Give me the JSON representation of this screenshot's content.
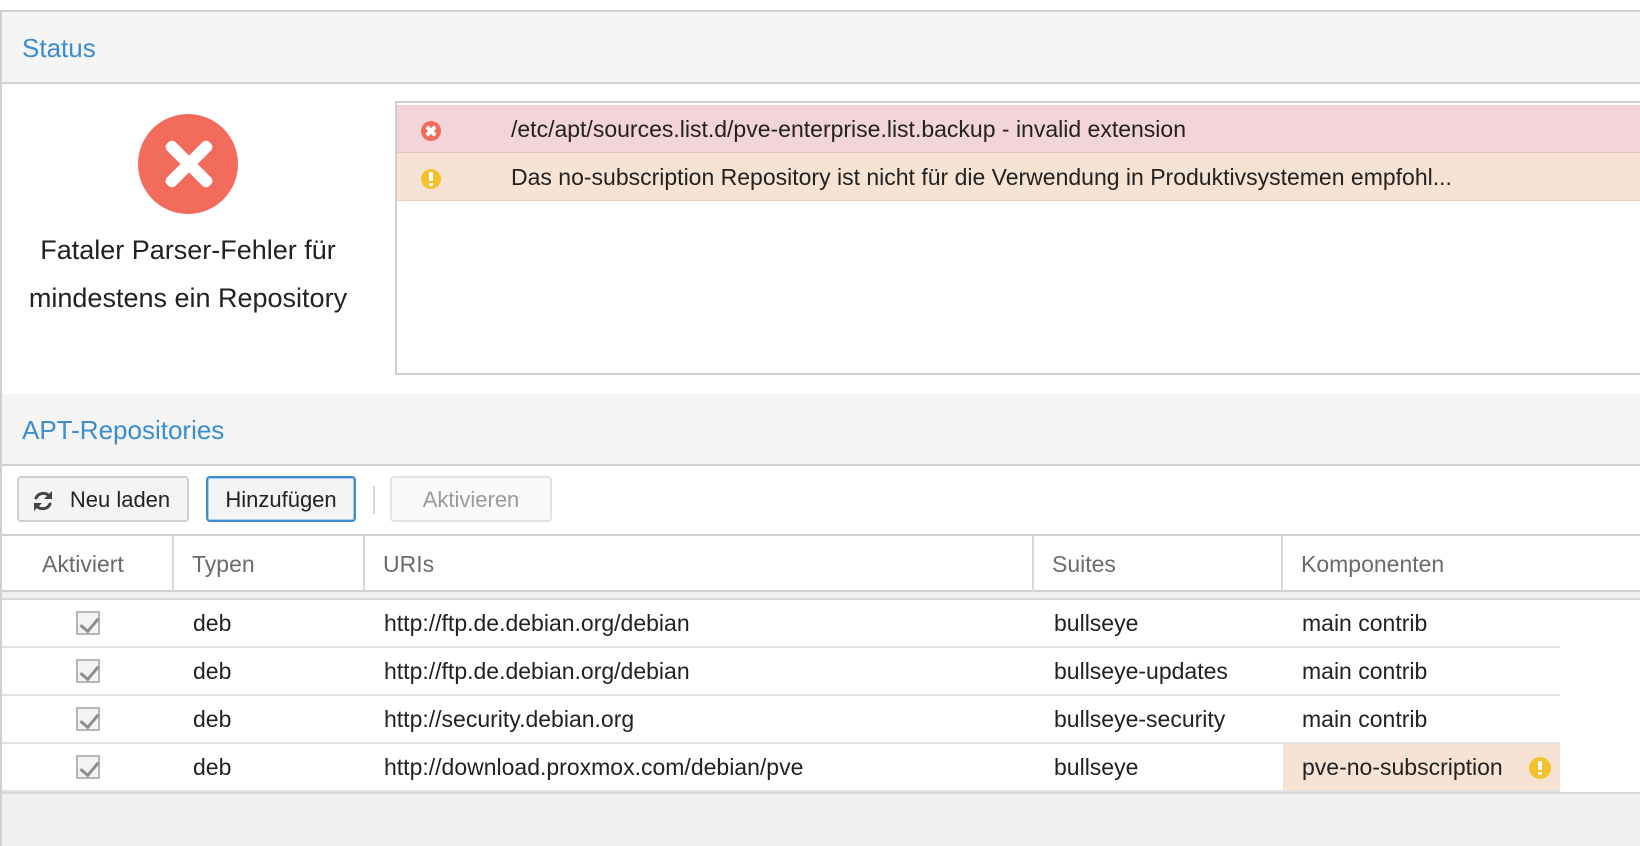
{
  "status_panel": {
    "title": "Status",
    "summary_icon": "error-circle-icon",
    "summary_text": "Fataler Parser-Fehler für mindestens ein Repository",
    "issues": [
      {
        "level": "error",
        "icon": "error-icon",
        "message": "/etc/apt/sources.list.d/pve-enterprise.list.backup - invalid extension"
      },
      {
        "level": "warning",
        "icon": "warning-icon",
        "message": "Das no-subscription Repository ist nicht für die Verwendung in Produktivsystemen empfohl..."
      }
    ]
  },
  "repos_panel": {
    "title": "APT-Repositories",
    "toolbar": {
      "reload_label": "Neu laden",
      "add_label": "Hinzufügen",
      "activate_label": "Aktivieren"
    },
    "columns": [
      "Aktiviert",
      "Typen",
      "URIs",
      "Suites",
      "Komponenten"
    ],
    "rows": [
      {
        "enabled": true,
        "type": "deb",
        "uri": "http://ftp.de.debian.org/debian",
        "suite": "bullseye",
        "components": "main contrib",
        "warning": false
      },
      {
        "enabled": true,
        "type": "deb",
        "uri": "http://ftp.de.debian.org/debian",
        "suite": "bullseye-updates",
        "components": "main contrib",
        "warning": false
      },
      {
        "enabled": true,
        "type": "deb",
        "uri": "http://security.debian.org",
        "suite": "bullseye-security",
        "components": "main contrib",
        "warning": false
      },
      {
        "enabled": true,
        "type": "deb",
        "uri": "http://download.proxmox.com/debian/pve",
        "suite": "bullseye",
        "components": "pve-no-subscription",
        "warning": true
      }
    ]
  },
  "colors": {
    "accent": "#3a8dd0",
    "error": "#f26b5b",
    "warning": "#f3c12c",
    "error_row_bg": "#f3d5d9",
    "warning_row_bg": "#f6e3d3"
  }
}
